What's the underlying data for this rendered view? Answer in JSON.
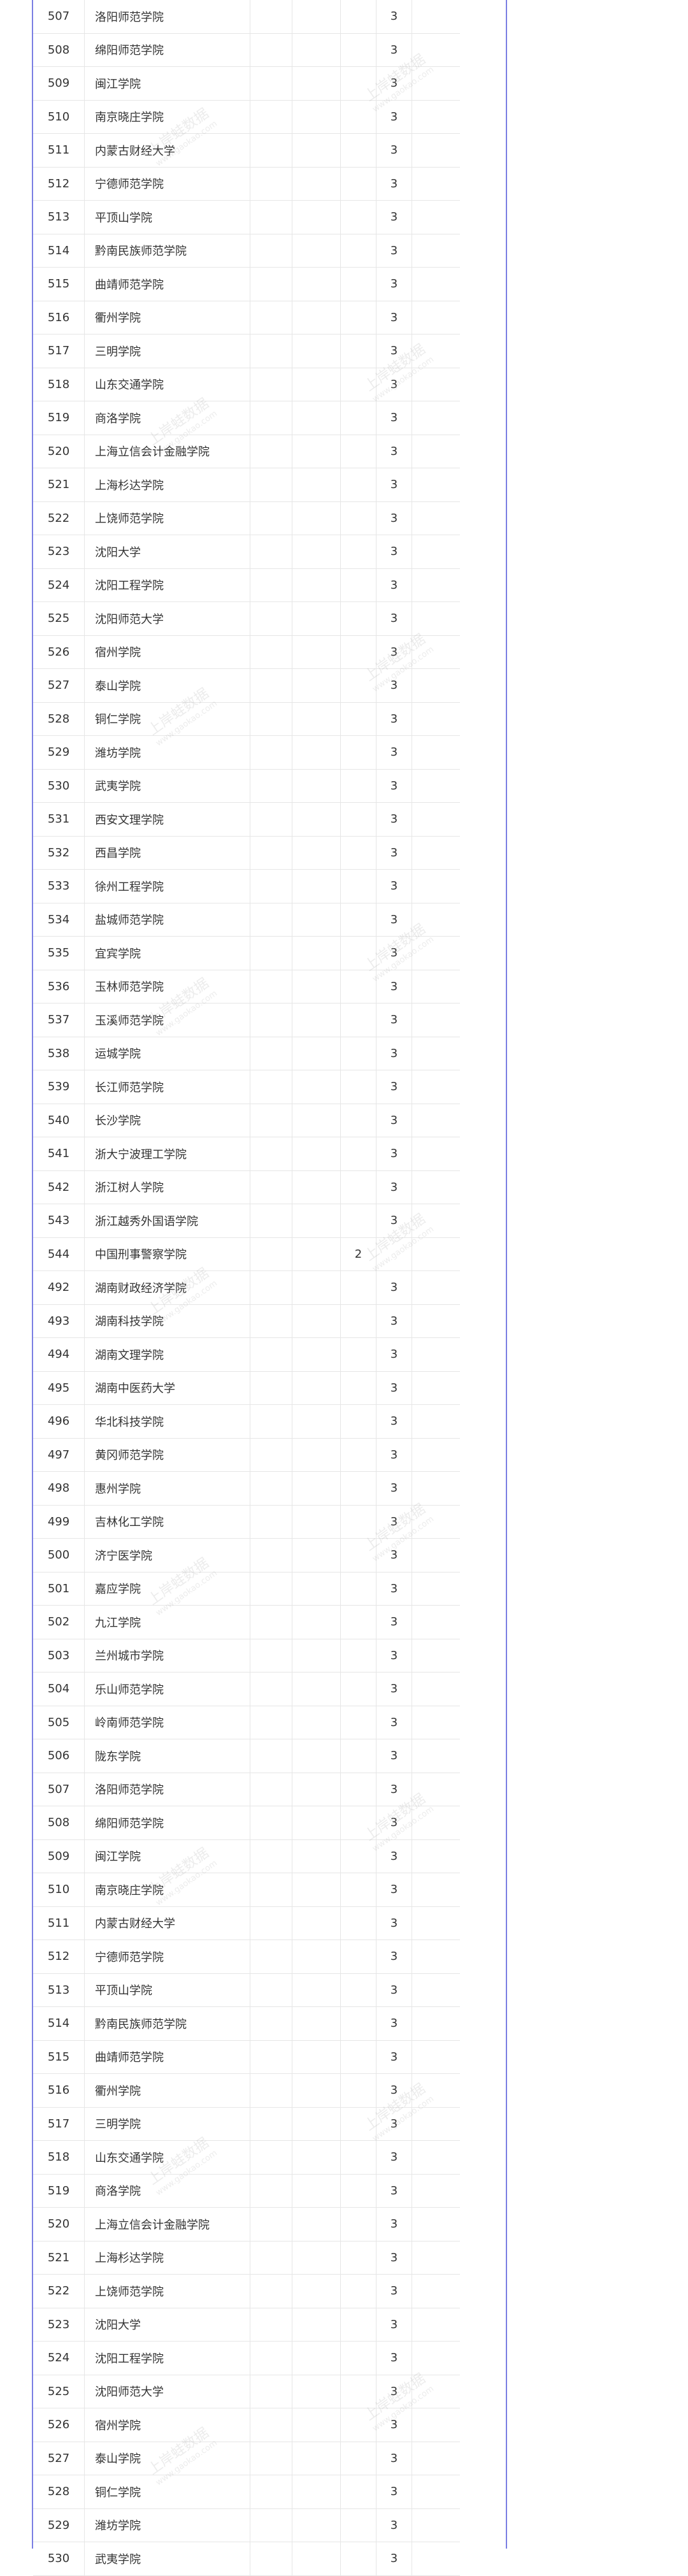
{
  "table": {
    "rows": [
      {
        "num": "507",
        "name": "洛阳师范学院",
        "c": "",
        "d": "3"
      },
      {
        "num": "508",
        "name": "绵阳师范学院",
        "c": "",
        "d": "3"
      },
      {
        "num": "509",
        "name": "闽江学院",
        "c": "",
        "d": "3"
      },
      {
        "num": "510",
        "name": "南京晓庄学院",
        "c": "",
        "d": "3"
      },
      {
        "num": "511",
        "name": "内蒙古财经大学",
        "c": "",
        "d": "3"
      },
      {
        "num": "512",
        "name": "宁德师范学院",
        "c": "",
        "d": "3"
      },
      {
        "num": "513",
        "name": "平顶山学院",
        "c": "",
        "d": "3"
      },
      {
        "num": "514",
        "name": "黔南民族师范学院",
        "c": "",
        "d": "3"
      },
      {
        "num": "515",
        "name": "曲靖师范学院",
        "c": "",
        "d": "3"
      },
      {
        "num": "516",
        "name": "衢州学院",
        "c": "",
        "d": "3"
      },
      {
        "num": "517",
        "name": "三明学院",
        "c": "",
        "d": "3"
      },
      {
        "num": "518",
        "name": "山东交通学院",
        "c": "",
        "d": "3"
      },
      {
        "num": "519",
        "name": "商洛学院",
        "c": "",
        "d": "3"
      },
      {
        "num": "520",
        "name": "上海立信会计金融学院",
        "c": "",
        "d": "3"
      },
      {
        "num": "521",
        "name": "上海杉达学院",
        "c": "",
        "d": "3"
      },
      {
        "num": "522",
        "name": "上饶师范学院",
        "c": "",
        "d": "3"
      },
      {
        "num": "523",
        "name": "沈阳大学",
        "c": "",
        "d": "3"
      },
      {
        "num": "524",
        "name": "沈阳工程学院",
        "c": "",
        "d": "3"
      },
      {
        "num": "525",
        "name": "沈阳师范大学",
        "c": "",
        "d": "3"
      },
      {
        "num": "526",
        "name": "宿州学院",
        "c": "",
        "d": "3"
      },
      {
        "num": "527",
        "name": "泰山学院",
        "c": "",
        "d": "3"
      },
      {
        "num": "528",
        "name": "铜仁学院",
        "c": "",
        "d": "3"
      },
      {
        "num": "529",
        "name": "潍坊学院",
        "c": "",
        "d": "3"
      },
      {
        "num": "530",
        "name": "武夷学院",
        "c": "",
        "d": "3"
      },
      {
        "num": "531",
        "name": "西安文理学院",
        "c": "",
        "d": "3"
      },
      {
        "num": "532",
        "name": "西昌学院",
        "c": "",
        "d": "3"
      },
      {
        "num": "533",
        "name": "徐州工程学院",
        "c": "",
        "d": "3"
      },
      {
        "num": "534",
        "name": "盐城师范学院",
        "c": "",
        "d": "3"
      },
      {
        "num": "535",
        "name": "宜宾学院",
        "c": "",
        "d": "3"
      },
      {
        "num": "536",
        "name": "玉林师范学院",
        "c": "",
        "d": "3"
      },
      {
        "num": "537",
        "name": "玉溪师范学院",
        "c": "",
        "d": "3"
      },
      {
        "num": "538",
        "name": "运城学院",
        "c": "",
        "d": "3"
      },
      {
        "num": "539",
        "name": "长江师范学院",
        "c": "",
        "d": "3"
      },
      {
        "num": "540",
        "name": "长沙学院",
        "c": "",
        "d": "3"
      },
      {
        "num": "541",
        "name": "浙大宁波理工学院",
        "c": "",
        "d": "3"
      },
      {
        "num": "542",
        "name": "浙江树人学院",
        "c": "",
        "d": "3"
      },
      {
        "num": "543",
        "name": "浙江越秀外国语学院",
        "c": "",
        "d": "3"
      },
      {
        "num": "544",
        "name": "中国刑事警察学院",
        "c": "2",
        "d": ""
      },
      {
        "num": "492",
        "name": "湖南财政经济学院",
        "c": "",
        "d": "3"
      },
      {
        "num": "493",
        "name": "湖南科技学院",
        "c": "",
        "d": "3"
      },
      {
        "num": "494",
        "name": "湖南文理学院",
        "c": "",
        "d": "3"
      },
      {
        "num": "495",
        "name": "湖南中医药大学",
        "c": "",
        "d": "3"
      },
      {
        "num": "496",
        "name": "华北科技学院",
        "c": "",
        "d": "3"
      },
      {
        "num": "497",
        "name": "黄冈师范学院",
        "c": "",
        "d": "3"
      },
      {
        "num": "498",
        "name": "惠州学院",
        "c": "",
        "d": "3"
      },
      {
        "num": "499",
        "name": "吉林化工学院",
        "c": "",
        "d": "3"
      },
      {
        "num": "500",
        "name": "济宁医学院",
        "c": "",
        "d": "3"
      },
      {
        "num": "501",
        "name": "嘉应学院",
        "c": "",
        "d": "3"
      },
      {
        "num": "502",
        "name": "九江学院",
        "c": "",
        "d": "3"
      },
      {
        "num": "503",
        "name": "兰州城市学院",
        "c": "",
        "d": "3"
      },
      {
        "num": "504",
        "name": "乐山师范学院",
        "c": "",
        "d": "3"
      },
      {
        "num": "505",
        "name": "岭南师范学院",
        "c": "",
        "d": "3"
      },
      {
        "num": "506",
        "name": "陇东学院",
        "c": "",
        "d": "3"
      },
      {
        "num": "507",
        "name": "洛阳师范学院",
        "c": "",
        "d": "3"
      },
      {
        "num": "508",
        "name": "绵阳师范学院",
        "c": "",
        "d": "3"
      },
      {
        "num": "509",
        "name": "闽江学院",
        "c": "",
        "d": "3"
      },
      {
        "num": "510",
        "name": "南京晓庄学院",
        "c": "",
        "d": "3"
      },
      {
        "num": "511",
        "name": "内蒙古财经大学",
        "c": "",
        "d": "3"
      },
      {
        "num": "512",
        "name": "宁德师范学院",
        "c": "",
        "d": "3"
      },
      {
        "num": "513",
        "name": "平顶山学院",
        "c": "",
        "d": "3"
      },
      {
        "num": "514",
        "name": "黔南民族师范学院",
        "c": "",
        "d": "3"
      },
      {
        "num": "515",
        "name": "曲靖师范学院",
        "c": "",
        "d": "3"
      },
      {
        "num": "516",
        "name": "衢州学院",
        "c": "",
        "d": "3"
      },
      {
        "num": "517",
        "name": "三明学院",
        "c": "",
        "d": "3"
      },
      {
        "num": "518",
        "name": "山东交通学院",
        "c": "",
        "d": "3"
      },
      {
        "num": "519",
        "name": "商洛学院",
        "c": "",
        "d": "3"
      },
      {
        "num": "520",
        "name": "上海立信会计金融学院",
        "c": "",
        "d": "3"
      },
      {
        "num": "521",
        "name": "上海杉达学院",
        "c": "",
        "d": "3"
      },
      {
        "num": "522",
        "name": "上饶师范学院",
        "c": "",
        "d": "3"
      },
      {
        "num": "523",
        "name": "沈阳大学",
        "c": "",
        "d": "3"
      },
      {
        "num": "524",
        "name": "沈阳工程学院",
        "c": "",
        "d": "3"
      },
      {
        "num": "525",
        "name": "沈阳师范大学",
        "c": "",
        "d": "3"
      },
      {
        "num": "526",
        "name": "宿州学院",
        "c": "",
        "d": "3"
      },
      {
        "num": "527",
        "name": "泰山学院",
        "c": "",
        "d": "3"
      },
      {
        "num": "528",
        "name": "铜仁学院",
        "c": "",
        "d": "3"
      },
      {
        "num": "529",
        "name": "潍坊学院",
        "c": "",
        "d": "3"
      },
      {
        "num": "530",
        "name": "武夷学院",
        "c": "",
        "d": "3"
      }
    ]
  },
  "watermark": {
    "title": "上岸蛙数据",
    "url": "www.gaokao.com"
  }
}
